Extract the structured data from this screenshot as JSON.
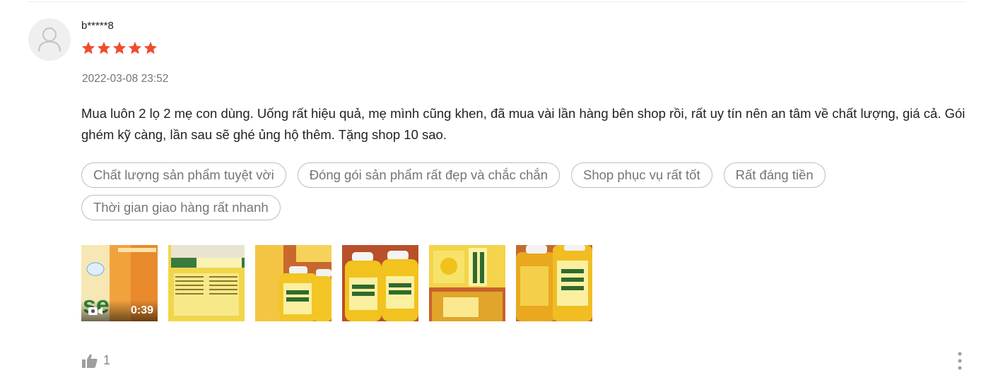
{
  "review": {
    "username": "b*****8",
    "rating": 5,
    "max_rating": 5,
    "timestamp": "2022-03-08 23:52",
    "comment": "Mua luôn 2 lọ 2 mẹ con dùng. Uống rất hiệu quả, mẹ mình cũng khen, đã mua vài lần hàng bên shop rồi, rất uy tín nên an tâm về chất lượng, giá cả. Gói ghém kỹ càng, lần sau sẽ ghé ủng hộ thêm. Tặng shop 10 sao.",
    "tags": [
      "Chất lượng sản phẩm tuyệt vời",
      "Đóng gói sản phẩm rất đẹp và chắc chắn",
      "Shop phục vụ rất tốt",
      "Rất đáng tiền",
      "Thời gian giao hàng rất nhanh"
    ],
    "video_duration": "0:39",
    "like_count": "1",
    "star_color": "#ee4d2d"
  }
}
